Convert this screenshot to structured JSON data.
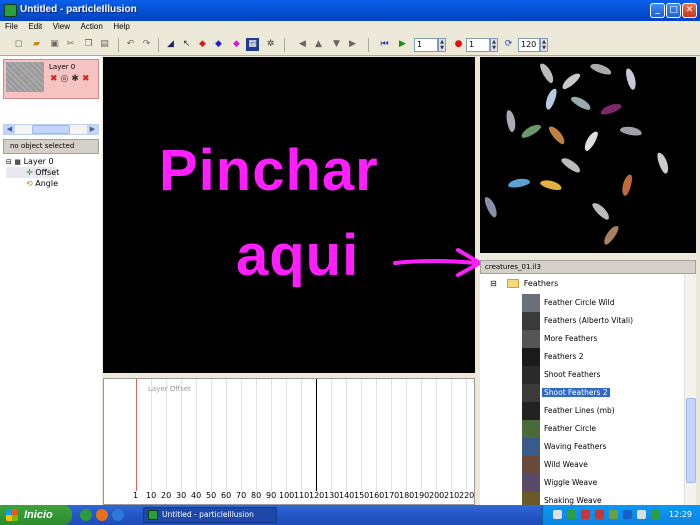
{
  "window": {
    "title": "Untitled - particleIllusion"
  },
  "menu": [
    "File",
    "Edit",
    "View",
    "Action",
    "Help"
  ],
  "toolbar": {
    "frame_value": "1",
    "frame_value2": "1",
    "fps_value": "120"
  },
  "left_panel": {
    "layer_name": "Layer 0",
    "no_object": "no object selected",
    "tree": {
      "layer": "Layer 0",
      "offset": "Offset",
      "angle": "Angle"
    }
  },
  "overlay": {
    "line1": "Pinchar",
    "line2": "aqui"
  },
  "library": {
    "file": "creatures_01.il3",
    "folder": "Feathers",
    "items": [
      {
        "label": "Feather Circle Wild",
        "selected": false
      },
      {
        "label": "Feathers (Alberto Vitali)",
        "selected": false
      },
      {
        "label": "More Feathers",
        "selected": false
      },
      {
        "label": "Feathers 2",
        "selected": false
      },
      {
        "label": "Shoot Feathers",
        "selected": false
      },
      {
        "label": "Shoot Feathers 2",
        "selected": true
      },
      {
        "label": "Feather Lines (mb)",
        "selected": false
      },
      {
        "label": "Feather Circle",
        "selected": false
      },
      {
        "label": "Waving Feathers",
        "selected": false
      },
      {
        "label": "Wild Weave",
        "selected": false
      },
      {
        "label": "Wiggle Weave",
        "selected": false
      },
      {
        "label": "Shaking Weave",
        "selected": false
      }
    ]
  },
  "timeline": {
    "layer_label": "Layer Offset",
    "ticks": [
      "1",
      "10",
      "20",
      "30",
      "40",
      "50",
      "60",
      "70",
      "80",
      "90",
      "100",
      "110",
      "120",
      "130",
      "140",
      "150",
      "160",
      "170",
      "180",
      "190",
      "200",
      "210",
      "220"
    ]
  },
  "taskbar": {
    "start": "Inicio",
    "task_item": "Untitled - particleIllusion",
    "clock": "12:29"
  },
  "colors": {
    "overlay_text": "#FF1EFF",
    "selected_item": "#316AC5",
    "titlebar": "#0A5FEA"
  }
}
